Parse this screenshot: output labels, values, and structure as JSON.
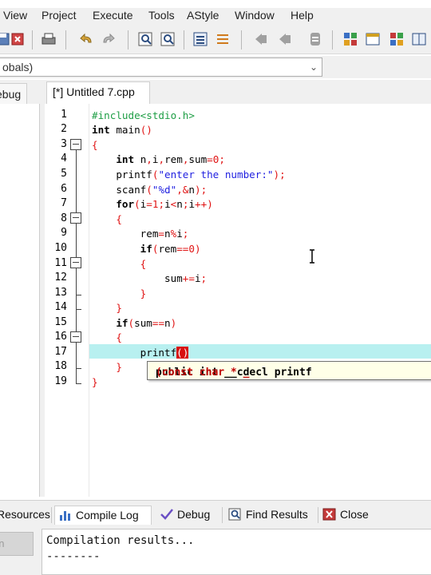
{
  "menubar": {
    "items": [
      "View",
      "Project",
      "Execute",
      "Tools",
      "AStyle",
      "Window",
      "Help"
    ]
  },
  "toolbar": {
    "buttons": [
      "save-all-icon",
      "close-icon",
      "print-icon",
      "undo-icon",
      "redo-icon",
      "find-icon",
      "replace-icon",
      "indent-icon",
      "unindent-icon",
      "bookmark-icon",
      "goto-icon",
      "toggle-icon",
      "layout-icon",
      "window-icon",
      "grid-icon",
      "tile-icon"
    ]
  },
  "scope_combo": {
    "value": "obals)"
  },
  "tabs": {
    "debug_label": "ebug",
    "file_label": "[*] Untitled 7.cpp"
  },
  "editor": {
    "line_numbers": [
      "1",
      "2",
      "3",
      "4",
      "5",
      "6",
      "7",
      "8",
      "9",
      "10",
      "11",
      "12",
      "13",
      "14",
      "15",
      "16",
      "17",
      "18",
      "19"
    ],
    "lines": [
      "#include<stdio.h>",
      "int main()",
      "{",
      "    int n,i,rem,sum=0;",
      "    printf(\"enter the number:\");",
      "    scanf(\"%d\",&n);",
      "    for(i=1;i<n;i++)",
      "    {",
      "        rem=n%i;",
      "        if(rem==0)",
      "        {",
      "            sum+=i;",
      "        }",
      "    }",
      "    if(sum==n)",
      "    {",
      "        printf()",
      "    }",
      "}"
    ],
    "tooltip": "public int __cdecl printf (const char * _"
  },
  "bottom_tabs": {
    "resources": "Resources",
    "compile_log": "Compile Log",
    "debug": "Debug",
    "find_results": "Find Results",
    "close": "Close"
  },
  "output": {
    "side_button": "on",
    "line1": "Compilation results...",
    "line2": "--------"
  },
  "colors": {
    "highlight_line": "#b8f0f0",
    "preprocessor": "#1e9e45",
    "string": "#1f1fe0",
    "number": "#e01414"
  }
}
